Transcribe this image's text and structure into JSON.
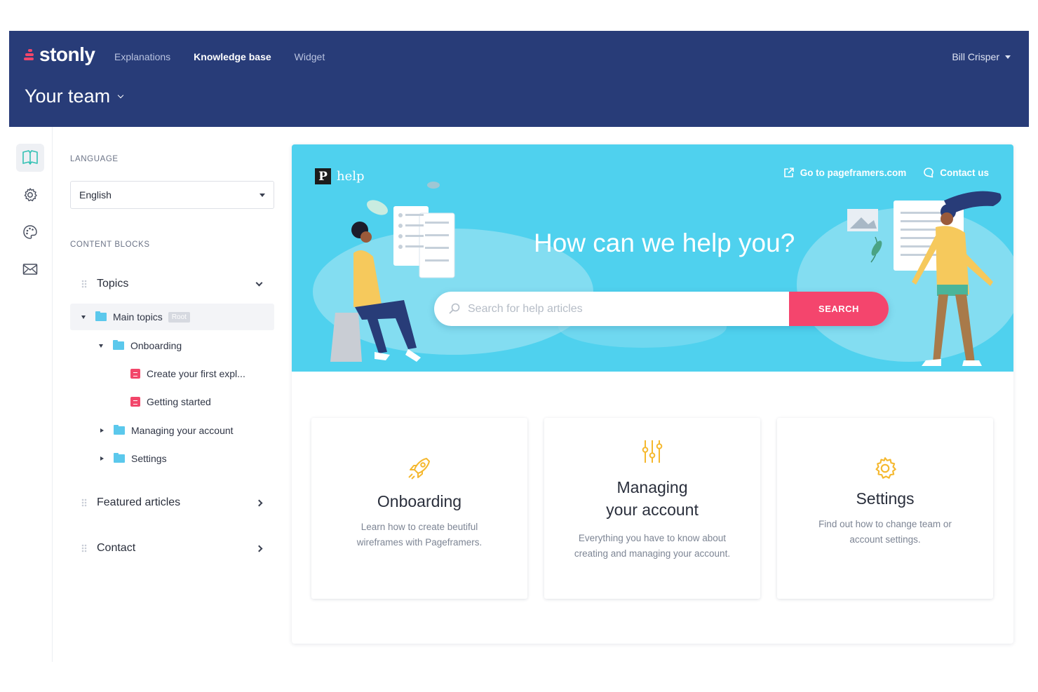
{
  "header": {
    "brand": "stonly",
    "nav": [
      "Explanations",
      "Knowledge base",
      "Widget"
    ],
    "user": "Bill Crisper",
    "team": "Your team"
  },
  "sidebar": {
    "language_label": "LANGUAGE",
    "language_value": "English",
    "content_blocks_label": "CONTENT BLOCKS",
    "blocks": {
      "topics": "Topics",
      "featured": "Featured articles",
      "contact": "Contact"
    },
    "tree": {
      "main_topics": "Main topics",
      "root_badge": "Root",
      "onboarding": "Onboarding",
      "create_first": "Create your first expl...",
      "getting_started": "Getting started",
      "managing": "Managing your account",
      "settings": "Settings"
    }
  },
  "preview": {
    "brand": "help",
    "links": {
      "site": "Go to pageframers.com",
      "contact": "Contact us"
    },
    "title": "How can we help you?",
    "search_placeholder": "Search for help articles",
    "search_button": "SEARCH",
    "cards": [
      {
        "title": "Onboarding",
        "desc1": "Learn how to create beutiful",
        "desc2": "wireframes with Pageframers."
      },
      {
        "title1": "Managing",
        "title2": "your account",
        "desc1": "Everything you have to know about",
        "desc2": "creating and managing your account."
      },
      {
        "title": "Settings",
        "desc1": "Find out how to change team or",
        "desc2": "account settings."
      }
    ]
  },
  "colors": {
    "header_bg": "#283c78",
    "hero_bg": "#4fd1ee",
    "accent_pink": "#f4456d",
    "icon_yellow": "#f5b82e"
  }
}
